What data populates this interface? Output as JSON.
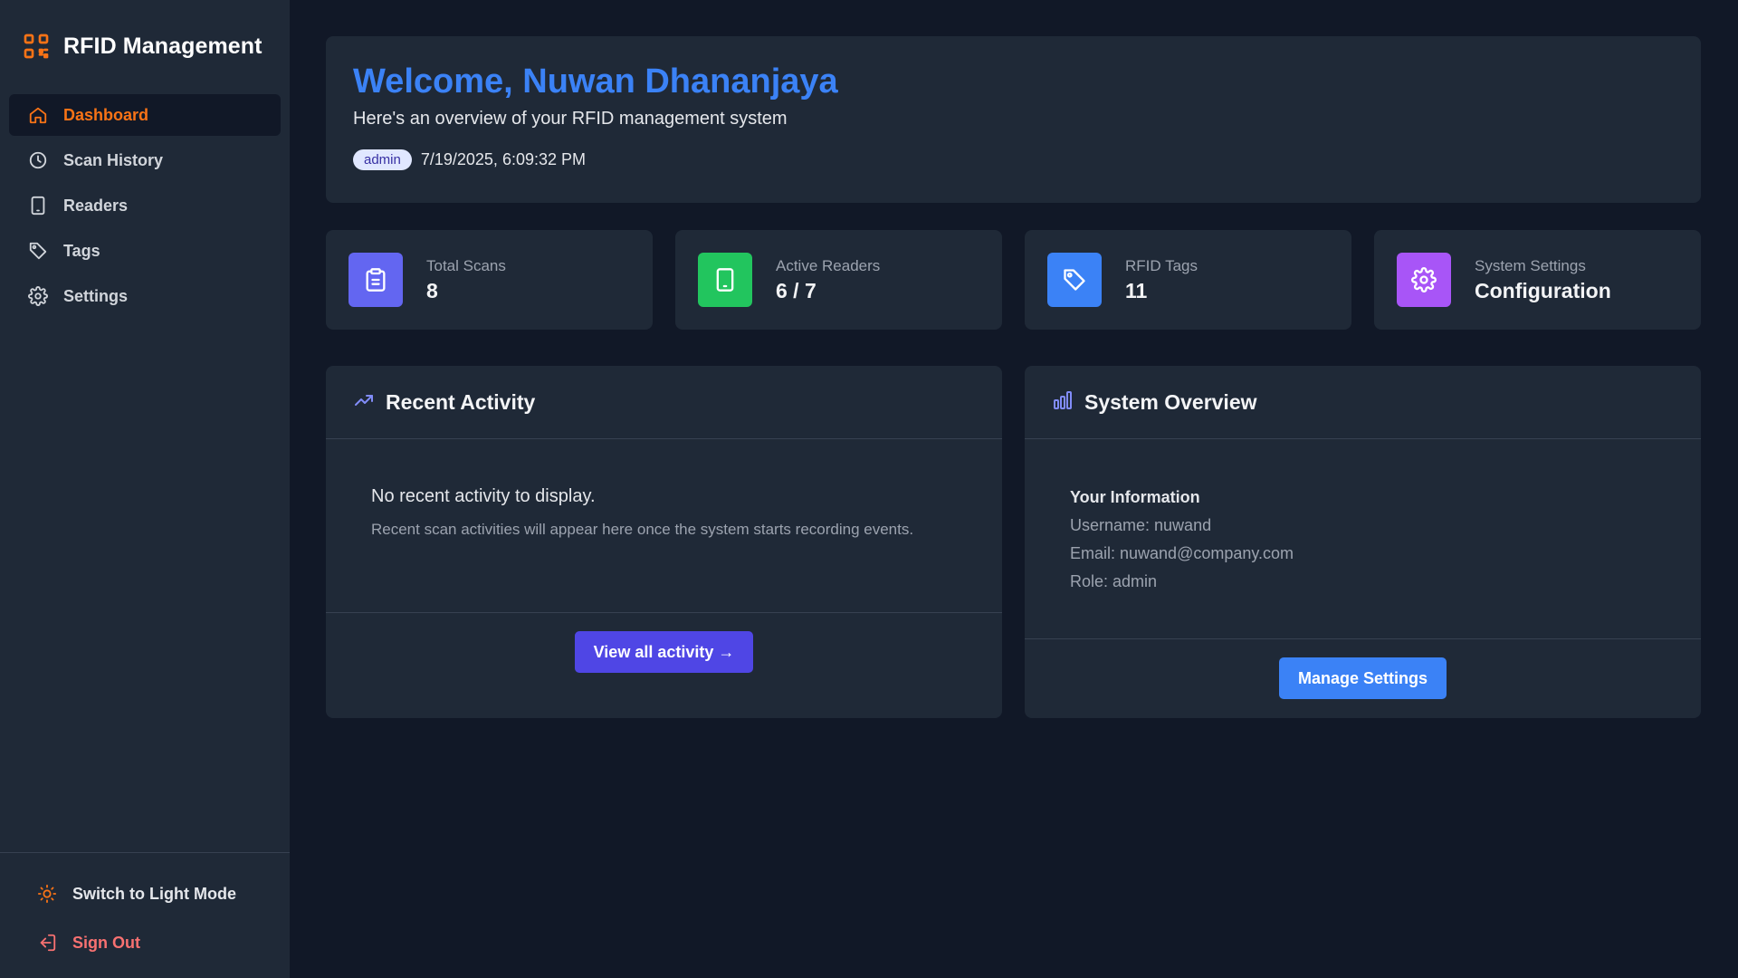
{
  "app": {
    "title": "RFID Management"
  },
  "sidebar": {
    "items": [
      {
        "label": "Dashboard",
        "icon": "home-icon",
        "active": true
      },
      {
        "label": "Scan History",
        "icon": "clock-icon",
        "active": false
      },
      {
        "label": "Readers",
        "icon": "tablet-icon",
        "active": false
      },
      {
        "label": "Tags",
        "icon": "tag-icon",
        "active": false
      },
      {
        "label": "Settings",
        "icon": "gear-icon",
        "active": false
      }
    ],
    "theme_toggle": "Switch to Light Mode",
    "sign_out": "Sign Out"
  },
  "welcome": {
    "title": "Welcome, Nuwan Dhananjaya",
    "subtitle": "Here's an overview of your RFID management system",
    "role": "admin",
    "datetime": "7/19/2025, 6:09:32 PM"
  },
  "stats": [
    {
      "label": "Total Scans",
      "value": "8",
      "icon": "clipboard-icon",
      "color": "#6366f1"
    },
    {
      "label": "Active Readers",
      "value": "6 / 7",
      "icon": "tablet-icon",
      "color": "#22c55e"
    },
    {
      "label": "RFID Tags",
      "value": "11",
      "icon": "tag-icon",
      "color": "#3b82f6"
    },
    {
      "label": "System Settings",
      "value": "Configuration",
      "icon": "gear-icon",
      "color": "#a855f7"
    }
  ],
  "recent_activity": {
    "title": "Recent Activity",
    "empty_title": "No recent activity to display.",
    "empty_text": "Recent scan activities will appear here once the system starts recording events.",
    "button": "View all activity →"
  },
  "system_overview": {
    "title": "System Overview",
    "info_title": "Your Information",
    "username": "Username: nuwand",
    "email": "Email: nuwand@company.com",
    "role": "Role: admin",
    "button": "Manage Settings"
  },
  "colors": {
    "accent": "#f97316",
    "primary_blue": "#3b82f6",
    "indigo": "#4f46e5",
    "danger": "#f87171",
    "background": "#111827",
    "surface": "#1f2937"
  }
}
